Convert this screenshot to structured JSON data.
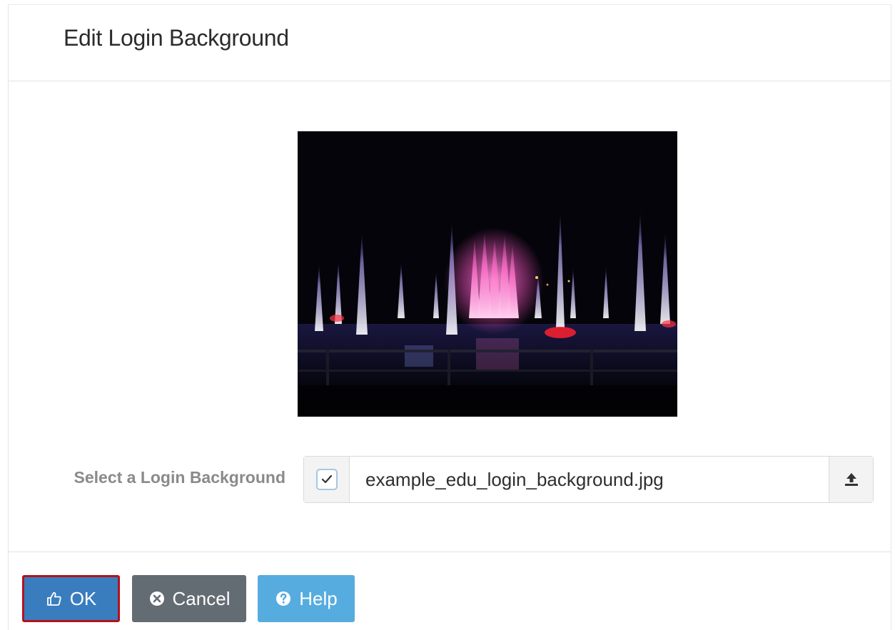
{
  "dialog": {
    "title": "Edit Login Background"
  },
  "preview": {
    "description_icon": "image-preview"
  },
  "form": {
    "label": "Select a Login Background",
    "checkbox_checked": true,
    "file_name": "example_edu_login_background.jpg",
    "upload_icon": "upload-icon"
  },
  "footer": {
    "ok_label": "OK",
    "ok_icon": "thumbs-up-icon",
    "cancel_label": "Cancel",
    "cancel_icon": "times-circle-icon",
    "help_label": "Help",
    "help_icon": "question-circle-icon"
  },
  "colors": {
    "ok_bg": "#3a7dbf",
    "ok_focus_border": "#b3121c",
    "cancel_bg": "#636b73",
    "help_bg": "#56acdf"
  }
}
